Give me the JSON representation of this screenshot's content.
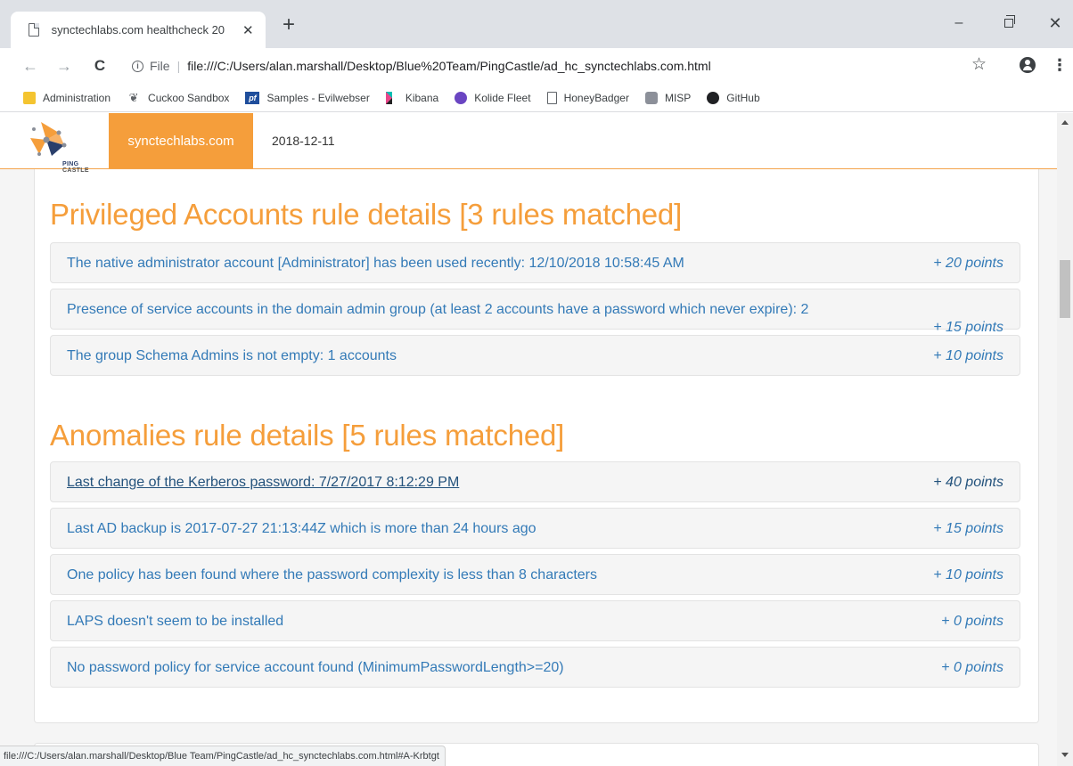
{
  "browser": {
    "tab_title": "synctechlabs.com healthcheck 20",
    "tab_close": "✕",
    "new_tab": "+",
    "window_controls": {
      "minimize": "–",
      "close": "✕"
    },
    "nav": {
      "back": "←",
      "forward": "→",
      "reload": "C"
    },
    "address": {
      "info": "i",
      "scheme_label": "File",
      "separator": "|",
      "url": "file:///C:/Users/alan.marshall/Desktop/Blue%20Team/PingCastle/ad_hc_synctechlabs.com.html"
    },
    "star": "☆",
    "menu": "⋮",
    "bookmarks": [
      {
        "label": "Administration",
        "icon": "folder-icon"
      },
      {
        "label": "Cuckoo Sandbox",
        "icon": "cuckoo-icon"
      },
      {
        "label": "Samples - Evilwebser",
        "icon": "pf-icon"
      },
      {
        "label": "Kibana",
        "icon": "kibana-icon"
      },
      {
        "label": "Kolide Fleet",
        "icon": "kolide-icon"
      },
      {
        "label": "HoneyBadger",
        "icon": "page-icon"
      },
      {
        "label": "MISP",
        "icon": "misp-icon"
      },
      {
        "label": "GitHub",
        "icon": "github-icon"
      }
    ],
    "status_url": "file:///C:/Users/alan.marshall/Desktop/Blue Team/PingCastle/ad_hc_synctechlabs.com.html#A-Krbtgt"
  },
  "site": {
    "logo_text_1": "PING",
    "logo_text_2": " CASTLE",
    "domain": "synctechlabs.com",
    "date": "2018-12-11",
    "accent_color": "#f59e3b",
    "link_color": "#337ab7"
  },
  "sections": [
    {
      "title": "Privileged Accounts rule details [3 rules matched]",
      "rules": [
        {
          "text": "The native administrator account [Administrator] has been used recently: 12/10/2018 10:58:45 AM",
          "points": "+ 20 points"
        },
        {
          "text": "Presence of service accounts in the domain admin group (at least 2 accounts have a password which never expire): 2",
          "points": "+ 15 points"
        },
        {
          "text": "The group Schema Admins is not empty: 1 accounts",
          "points": "+ 10 points"
        }
      ]
    },
    {
      "title": "Anomalies rule details [5 rules matched]",
      "rules": [
        {
          "text": "Last change of the Kerberos password: 7/27/2017 8:12:29 PM",
          "points": "+ 40 points"
        },
        {
          "text": "Last AD backup is 2017-07-27 21:13:44Z which is more than 24 hours ago",
          "points": "+ 15 points"
        },
        {
          "text": "One policy has been found where the password complexity is less than 8 characters",
          "points": "+ 10 points"
        },
        {
          "text": "LAPS doesn't seem to be installed",
          "points": "+ 0 points"
        },
        {
          "text": "No password policy for service account found (MinimumPasswordLength>=20)",
          "points": "+ 0 points"
        }
      ]
    }
  ]
}
